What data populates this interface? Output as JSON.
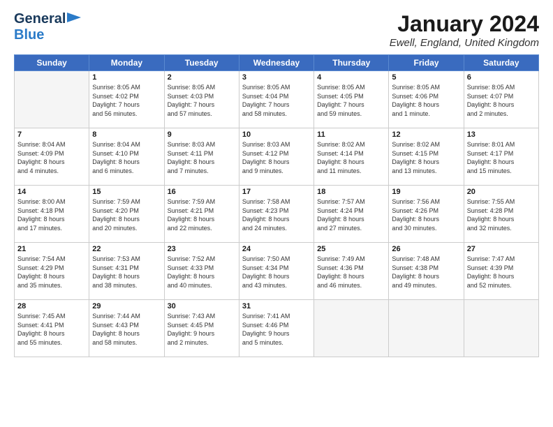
{
  "header": {
    "logo_general": "General",
    "logo_blue": "Blue",
    "month_title": "January 2024",
    "location": "Ewell, England, United Kingdom"
  },
  "days_of_week": [
    "Sunday",
    "Monday",
    "Tuesday",
    "Wednesday",
    "Thursday",
    "Friday",
    "Saturday"
  ],
  "weeks": [
    [
      {
        "day": "",
        "content": ""
      },
      {
        "day": "1",
        "content": "Sunrise: 8:05 AM\nSunset: 4:02 PM\nDaylight: 7 hours\nand 56 minutes."
      },
      {
        "day": "2",
        "content": "Sunrise: 8:05 AM\nSunset: 4:03 PM\nDaylight: 7 hours\nand 57 minutes."
      },
      {
        "day": "3",
        "content": "Sunrise: 8:05 AM\nSunset: 4:04 PM\nDaylight: 7 hours\nand 58 minutes."
      },
      {
        "day": "4",
        "content": "Sunrise: 8:05 AM\nSunset: 4:05 PM\nDaylight: 7 hours\nand 59 minutes."
      },
      {
        "day": "5",
        "content": "Sunrise: 8:05 AM\nSunset: 4:06 PM\nDaylight: 8 hours\nand 1 minute."
      },
      {
        "day": "6",
        "content": "Sunrise: 8:05 AM\nSunset: 4:07 PM\nDaylight: 8 hours\nand 2 minutes."
      }
    ],
    [
      {
        "day": "7",
        "content": "Sunrise: 8:04 AM\nSunset: 4:09 PM\nDaylight: 8 hours\nand 4 minutes."
      },
      {
        "day": "8",
        "content": "Sunrise: 8:04 AM\nSunset: 4:10 PM\nDaylight: 8 hours\nand 6 minutes."
      },
      {
        "day": "9",
        "content": "Sunrise: 8:03 AM\nSunset: 4:11 PM\nDaylight: 8 hours\nand 7 minutes."
      },
      {
        "day": "10",
        "content": "Sunrise: 8:03 AM\nSunset: 4:12 PM\nDaylight: 8 hours\nand 9 minutes."
      },
      {
        "day": "11",
        "content": "Sunrise: 8:02 AM\nSunset: 4:14 PM\nDaylight: 8 hours\nand 11 minutes."
      },
      {
        "day": "12",
        "content": "Sunrise: 8:02 AM\nSunset: 4:15 PM\nDaylight: 8 hours\nand 13 minutes."
      },
      {
        "day": "13",
        "content": "Sunrise: 8:01 AM\nSunset: 4:17 PM\nDaylight: 8 hours\nand 15 minutes."
      }
    ],
    [
      {
        "day": "14",
        "content": "Sunrise: 8:00 AM\nSunset: 4:18 PM\nDaylight: 8 hours\nand 17 minutes."
      },
      {
        "day": "15",
        "content": "Sunrise: 7:59 AM\nSunset: 4:20 PM\nDaylight: 8 hours\nand 20 minutes."
      },
      {
        "day": "16",
        "content": "Sunrise: 7:59 AM\nSunset: 4:21 PM\nDaylight: 8 hours\nand 22 minutes."
      },
      {
        "day": "17",
        "content": "Sunrise: 7:58 AM\nSunset: 4:23 PM\nDaylight: 8 hours\nand 24 minutes."
      },
      {
        "day": "18",
        "content": "Sunrise: 7:57 AM\nSunset: 4:24 PM\nDaylight: 8 hours\nand 27 minutes."
      },
      {
        "day": "19",
        "content": "Sunrise: 7:56 AM\nSunset: 4:26 PM\nDaylight: 8 hours\nand 30 minutes."
      },
      {
        "day": "20",
        "content": "Sunrise: 7:55 AM\nSunset: 4:28 PM\nDaylight: 8 hours\nand 32 minutes."
      }
    ],
    [
      {
        "day": "21",
        "content": "Sunrise: 7:54 AM\nSunset: 4:29 PM\nDaylight: 8 hours\nand 35 minutes."
      },
      {
        "day": "22",
        "content": "Sunrise: 7:53 AM\nSunset: 4:31 PM\nDaylight: 8 hours\nand 38 minutes."
      },
      {
        "day": "23",
        "content": "Sunrise: 7:52 AM\nSunset: 4:33 PM\nDaylight: 8 hours\nand 40 minutes."
      },
      {
        "day": "24",
        "content": "Sunrise: 7:50 AM\nSunset: 4:34 PM\nDaylight: 8 hours\nand 43 minutes."
      },
      {
        "day": "25",
        "content": "Sunrise: 7:49 AM\nSunset: 4:36 PM\nDaylight: 8 hours\nand 46 minutes."
      },
      {
        "day": "26",
        "content": "Sunrise: 7:48 AM\nSunset: 4:38 PM\nDaylight: 8 hours\nand 49 minutes."
      },
      {
        "day": "27",
        "content": "Sunrise: 7:47 AM\nSunset: 4:39 PM\nDaylight: 8 hours\nand 52 minutes."
      }
    ],
    [
      {
        "day": "28",
        "content": "Sunrise: 7:45 AM\nSunset: 4:41 PM\nDaylight: 8 hours\nand 55 minutes."
      },
      {
        "day": "29",
        "content": "Sunrise: 7:44 AM\nSunset: 4:43 PM\nDaylight: 8 hours\nand 58 minutes."
      },
      {
        "day": "30",
        "content": "Sunrise: 7:43 AM\nSunset: 4:45 PM\nDaylight: 9 hours\nand 2 minutes."
      },
      {
        "day": "31",
        "content": "Sunrise: 7:41 AM\nSunset: 4:46 PM\nDaylight: 9 hours\nand 5 minutes."
      },
      {
        "day": "",
        "content": ""
      },
      {
        "day": "",
        "content": ""
      },
      {
        "day": "",
        "content": ""
      }
    ]
  ]
}
